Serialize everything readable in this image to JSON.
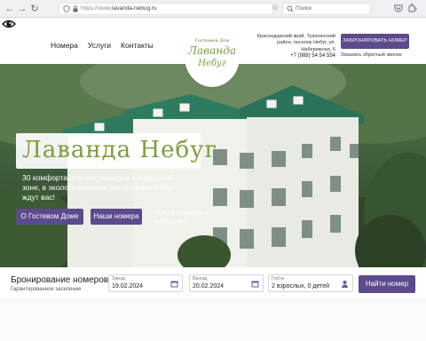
{
  "browser": {
    "url_scheme": "https://www.",
    "url_host": "lavanda-nebug.ru",
    "search_placeholder": "Поиск"
  },
  "header": {
    "nav": [
      "Номера",
      "Услуги",
      "Контакты"
    ],
    "address_lines": [
      "Краснодарский край, Туапсинский",
      "район, поселок Небуг, ул.",
      "Набережная, 6"
    ],
    "phone": "+7 (988) 54 54 554",
    "book_button": "ЗАБРОНИРОВАТЬ НОМЕР",
    "callback_link": "Заказать обратный звонок"
  },
  "logo": {
    "line1": "Гостевой Дом",
    "line2": "Лаванда",
    "line3": "Небуг"
  },
  "hero": {
    "title": "Лаванда Небуг",
    "subtitle": "30 комфортабельных номеров в курортной зоне, в экологически чистом поселке Небуг ждут вас!",
    "btn_about": "О Гостевом Доме",
    "btn_rooms": "Наши номера",
    "help_text": "Нужна помощь с выбором?"
  },
  "booking": {
    "title": "Бронирование номеров",
    "subtitle": "Гарантированное заселение",
    "checkin_label": "Заезд",
    "checkin_value": "19.02.2024",
    "checkout_label": "Выезд",
    "checkout_value": "20.02.2024",
    "guests_label": "Гости",
    "guests_value": "2 взрослых, 0 детей",
    "find_button": "Найти номер"
  },
  "colors": {
    "accent": "#5c4a8c",
    "logo_green": "#7b9c3a",
    "roof_green": "#2f7a5e"
  }
}
